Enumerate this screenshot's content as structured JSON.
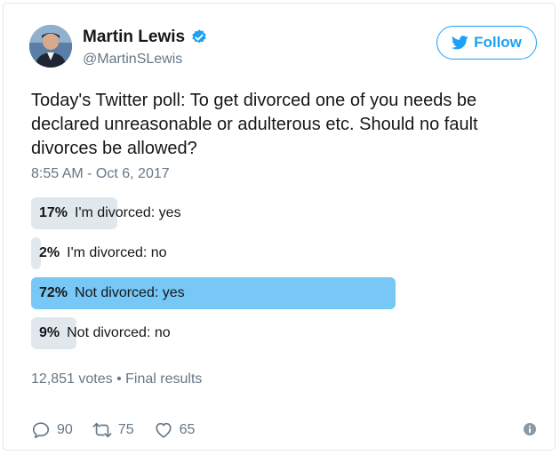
{
  "author": {
    "name": "Martin Lewis",
    "handle": "@MartinSLewis",
    "verified_icon": "verified-badge-icon"
  },
  "follow_button": {
    "label": "Follow",
    "icon": "twitter-bird-icon"
  },
  "tweet": {
    "text": "Today's Twitter poll: To get divorced one of you needs be declared unreasonable or adulterous etc. Should no fault divorces be allowed?",
    "timestamp": "8:55 AM - Oct 6, 2017"
  },
  "poll": {
    "options": [
      {
        "percent": "17%",
        "label": "I'm divorced: yes",
        "fraction": 0.17,
        "winner": false
      },
      {
        "percent": "2%",
        "label": "I'm divorced: no",
        "fraction": 0.02,
        "winner": false
      },
      {
        "percent": "72%",
        "label": "Not divorced: yes",
        "fraction": 0.72,
        "winner": true
      },
      {
        "percent": "9%",
        "label": "Not divorced: no",
        "fraction": 0.09,
        "winner": false
      }
    ],
    "votes": "12,851 votes",
    "separator": "•",
    "status": "Final results"
  },
  "actions": {
    "replies": "90",
    "retweets": "75",
    "likes": "65"
  },
  "colors": {
    "accent": "#1da1f2",
    "poll_bar": "#e1e8ed",
    "poll_winner": "#77c7f7",
    "secondary_text": "#657786"
  }
}
